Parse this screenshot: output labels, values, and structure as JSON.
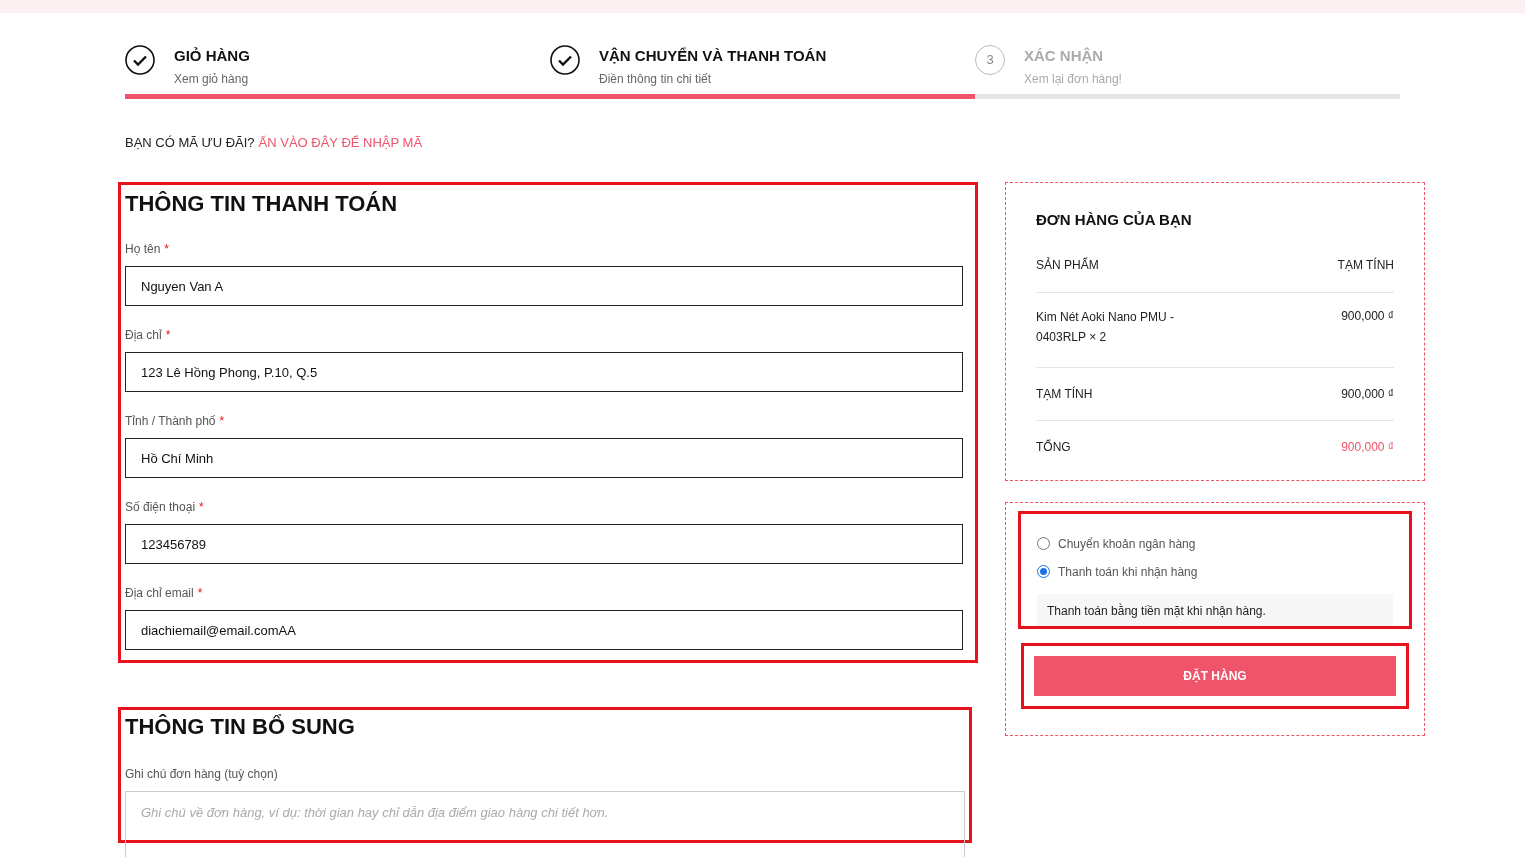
{
  "steps": [
    {
      "title": "GIỎ HÀNG",
      "subtitle": "Xem giỏ hàng",
      "done": true
    },
    {
      "title": "VẬN CHUYỂN VÀ THANH TOÁN",
      "subtitle": "Điền thông tin chi tiết",
      "done": true
    },
    {
      "title": "XÁC NHẬN",
      "subtitle": "Xem lại đơn hàng!",
      "done": false,
      "number": "3"
    }
  ],
  "progress": {
    "level": 0.667
  },
  "coupon": {
    "text": "BẠN CÓ MÃ ƯU ĐÃI?",
    "link": "ẤN VÀO ĐÂY ĐỂ NHẬP MÃ"
  },
  "billing": {
    "title": "THÔNG TIN THANH TOÁN",
    "fields": [
      {
        "label": "Họ tên",
        "required": true,
        "value": "Nguyen Van A"
      },
      {
        "label": "Địa chỉ",
        "required": true,
        "value": "123 Lê Hồng Phong, P.10, Q.5"
      },
      {
        "label": "Tỉnh / Thành phố",
        "required": true,
        "value": "Hồ Chí Minh"
      },
      {
        "label": "Số điện thoại",
        "required": true,
        "value": "123456789"
      },
      {
        "label": "Địa chỉ email",
        "required": true,
        "value": "diachiemail@email.comAA"
      }
    ],
    "required_mark": "*"
  },
  "additional": {
    "title": "THÔNG TIN BỔ SUNG",
    "label": "Ghi chú đơn hàng (tuỳ chọn)",
    "placeholder": "Ghi chú về đơn hàng, ví dụ: thời gian hay chỉ dẫn địa điểm giao hàng chi tiết hơn."
  },
  "order": {
    "title": "ĐƠN HÀNG CỦA BẠN",
    "columns": [
      "SẢN PHẨM",
      "TẠM TÍNH"
    ],
    "items": [
      {
        "name": "Kim Nét Aoki Nano PMU - 0403RLP",
        "qty": "× 2",
        "price": "900,000 ₫"
      }
    ],
    "subtotal": {
      "label": "TẠM TÍNH",
      "value": "900,000 ₫"
    },
    "total": {
      "label": "TỔNG",
      "value": "900,000 ₫"
    }
  },
  "payment": {
    "methods": [
      {
        "label": "Chuyển khoản ngân hàng",
        "selected": false
      },
      {
        "label": "Thanh toán khi nhận hàng",
        "selected": true,
        "description": "Thanh toán bằng tiền mặt khi nhận hàng."
      }
    ],
    "button": "ĐẶT HÀNG"
  }
}
